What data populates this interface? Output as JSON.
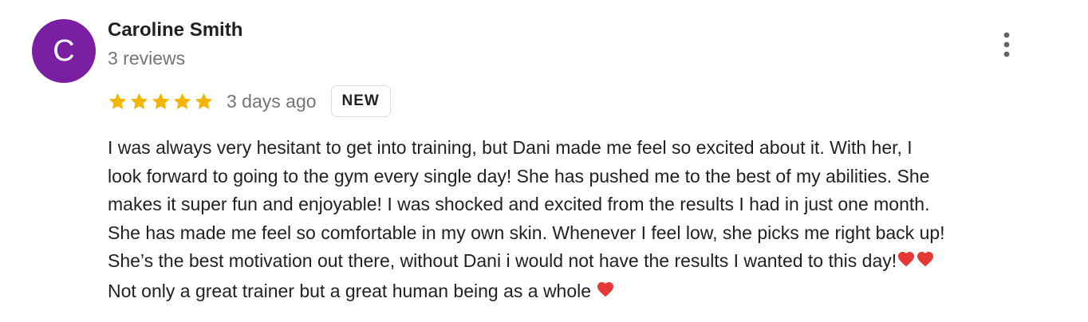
{
  "reviewer": {
    "initial": "C",
    "avatar_color": "#7b1fa2",
    "name": "Caroline Smith",
    "reviews_count": "3 reviews"
  },
  "more_options_icon": "vertical-dots-icon",
  "rating": {
    "stars": 5,
    "max_stars": 5,
    "star_color": "#f4b400",
    "time_ago": "3 days ago",
    "badge": "NEW"
  },
  "review": {
    "lines": [
      "I was always very hesitant to get into training, but Dani made me feel so excited about it. With her, I",
      "look forward to going to the gym every single day! She has pushed me to the best of my abilities. She",
      "makes it super fun and enjoyable! I was shocked and excited from the results I had in just one month.",
      "She has made me feel so comfortable in my own skin. Whenever I feel low, she picks me right back up!",
      "She’s the best motivation out there, without Dani i would not have the results I wanted to this day!",
      "Not only a great trainer but a great human being as a whole "
    ],
    "heart_color": "#e53935"
  }
}
